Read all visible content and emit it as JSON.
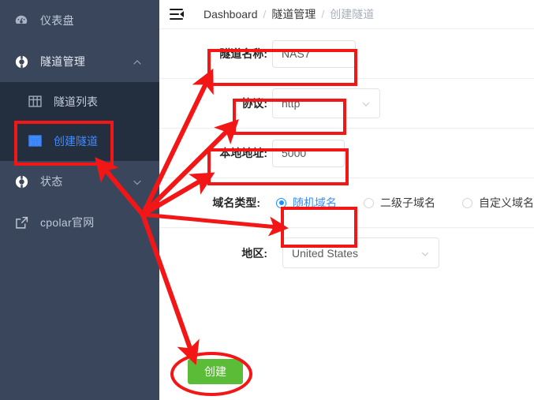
{
  "sidebar": {
    "items": [
      {
        "label": "仪表盘",
        "icon": "dashboard-icon",
        "has_chevron": false,
        "active": false
      },
      {
        "label": "隧道管理",
        "icon": "tunnel-icon",
        "has_chevron": true,
        "chevron": "chevron-up-icon",
        "active": true
      },
      {
        "label": "状态",
        "icon": "status-icon",
        "has_chevron": true,
        "chevron": "chevron-down-icon",
        "active": false
      },
      {
        "label": "cpolar官网",
        "icon": "external-link-icon",
        "has_chevron": false,
        "active": false
      }
    ],
    "submenu": [
      {
        "label": "隧道列表",
        "icon": "grid-icon",
        "active": false
      },
      {
        "label": "创建隧道",
        "icon": "grid-icon",
        "active": true
      }
    ],
    "bg_color": "#3a465c",
    "submenu_bg_color": "#232e3f",
    "active_color": "#3f8bff"
  },
  "topbar": {
    "menu_icon": "hamburger-collapse-icon",
    "breadcrumb": [
      {
        "label": "Dashboard",
        "current": false
      },
      {
        "label": "隧道管理",
        "current": false
      },
      {
        "label": "创建隧道",
        "current": true
      }
    ],
    "separator": "/"
  },
  "form": {
    "tunnel_name": {
      "label": "隧道名称:",
      "value": "NAS7",
      "placeholder": ""
    },
    "protocol": {
      "label": "协议:",
      "value": "http",
      "caret": "chevron-down-icon"
    },
    "local_address": {
      "label": "本地地址:",
      "value": "5000",
      "placeholder": ""
    },
    "domain_type": {
      "label": "域名类型:",
      "options": [
        {
          "label": "随机域名",
          "selected": true
        },
        {
          "label": "二级子域名",
          "selected": false
        },
        {
          "label": "自定义域名",
          "selected": false
        }
      ]
    },
    "region": {
      "label": "地区:",
      "value": "United States",
      "caret": "chevron-down-icon"
    },
    "submit": {
      "label": "创建",
      "color": "#5bbd37"
    }
  },
  "annotations": {
    "color": "#f31616",
    "boxes": [
      {
        "name": "highlight-create-tunnel-menu"
      },
      {
        "name": "highlight-tunnel-name-field"
      },
      {
        "name": "highlight-protocol-field"
      },
      {
        "name": "highlight-local-address-field"
      },
      {
        "name": "highlight-domain-type-option"
      }
    ],
    "ellipse": {
      "name": "highlight-create-button"
    },
    "arrows": 5
  }
}
